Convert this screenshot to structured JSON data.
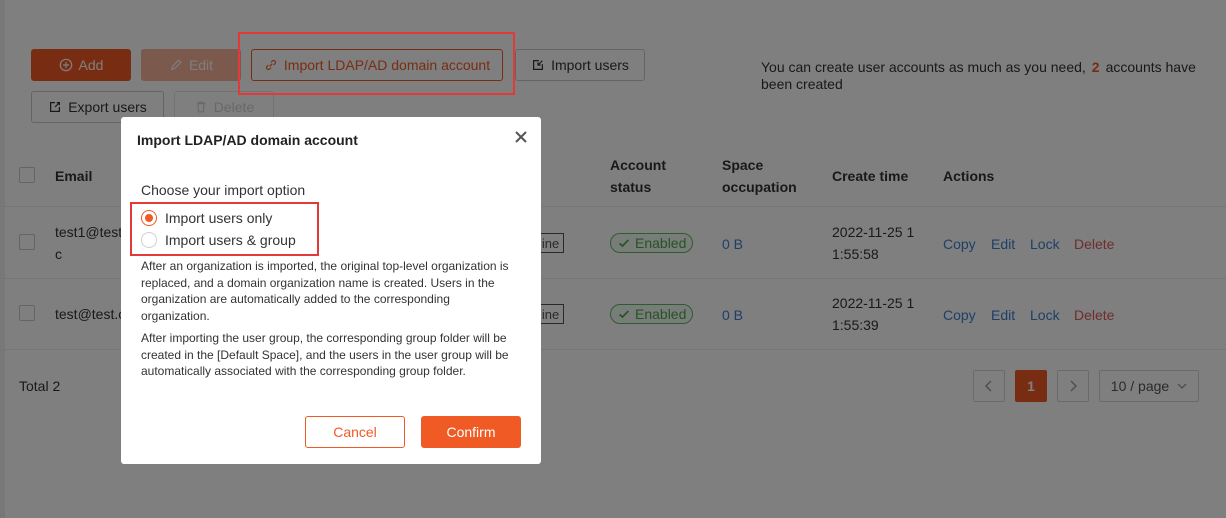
{
  "toolbar": {
    "add_label": "Add",
    "edit_label": "Edit",
    "import_ldap_label": "Import LDAP/AD domain account",
    "import_users_label": "Import users",
    "export_users_label": "Export users",
    "delete_label": "Delete"
  },
  "info": {
    "prefix": "You can create user accounts as much as you need,",
    "count": "2",
    "suffix": "accounts have been created"
  },
  "table": {
    "headers": {
      "email": "Email",
      "account_status": "Account status",
      "space_occupation": "Space occupation",
      "create_time": "Create time",
      "actions": "Actions"
    },
    "rows": [
      {
        "email": "test1@test.com",
        "email_visible_line1": "test1@test",
        "email_visible_line2": "c",
        "tag": "line",
        "status": "Enabled",
        "space": "0 B",
        "time_line1": "2022-11-25 1",
        "time_line2": "1:55:58",
        "actions": [
          "Copy",
          "Edit",
          "Lock",
          "Delete"
        ]
      },
      {
        "email_visible_line1": "test@test.c",
        "tag": "line",
        "status": "Enabled",
        "space": "0 B",
        "time_line1": "2022-11-25 1",
        "time_line2": "1:55:39",
        "actions": [
          "Copy",
          "Edit",
          "Lock",
          "Delete"
        ]
      }
    ]
  },
  "pagination": {
    "total": "Total 2",
    "current_page": "1",
    "page_size": "10 / page"
  },
  "modal": {
    "title": "Import LDAP/AD domain account",
    "option_title": "Choose your import option",
    "options": [
      {
        "label": "Import users only",
        "selected": true
      },
      {
        "label": "Import users & group",
        "selected": false
      }
    ],
    "desc1": "After an organization is imported, the original top-level organization is replaced, and a domain organization name is created. Users in the organization are automatically added to the corresponding organization.",
    "desc2": "After importing the user group, the corresponding group folder will be created in the [Default Space], and the users in the user group will be automatically associated with the corresponding group folder.",
    "cancel_label": "Cancel",
    "confirm_label": "Confirm"
  },
  "colors": {
    "accent": "#f05a24",
    "link": "#3b7fd0",
    "danger": "#e05a5a",
    "success": "#4aa84a",
    "highlight": "#e23a3a"
  },
  "icons": {
    "add": "plus-circle-icon",
    "edit": "pencil-icon",
    "import_ldap": "link-icon",
    "import_users": "import-icon",
    "export_users": "export-icon",
    "delete": "trash-icon",
    "close": "close-icon",
    "status": "check-icon"
  }
}
